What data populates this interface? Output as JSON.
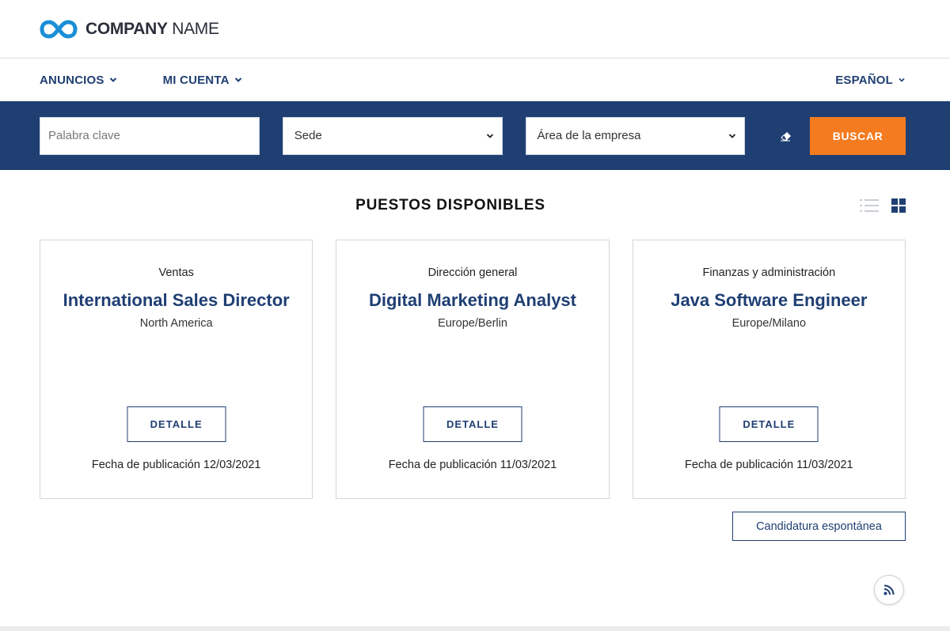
{
  "header": {
    "logo_bold": "COMPANY",
    "logo_light": " NAME",
    "brand_color": "#1a8fd6"
  },
  "nav": {
    "items": [
      {
        "label": "ANUNCIOS"
      },
      {
        "label": "MI CUENTA"
      }
    ],
    "language": "ESPAÑOL"
  },
  "search": {
    "keyword_placeholder": "Palabra clave",
    "location_select": "Sede",
    "area_select": "Área de la empresa",
    "button_label": "BUSCAR",
    "bar_color": "#1f3f73",
    "button_color": "#f47b20"
  },
  "section": {
    "title": "PUESTOS DISPONIBLES"
  },
  "jobs": [
    {
      "area": "Ventas",
      "title": "International Sales Director",
      "location": "North America",
      "detail_label": "DETALLE",
      "pub_date": "Fecha de publicación 12/03/2021"
    },
    {
      "area": "Dirección general",
      "title": "Digital Marketing Analyst",
      "location": "Europe/Berlin",
      "detail_label": "DETALLE",
      "pub_date": "Fecha de publicación 11/03/2021"
    },
    {
      "area": "Finanzas y administración",
      "title": "Java Software Engineer",
      "location": "Europe/Milano",
      "detail_label": "DETALLE",
      "pub_date": "Fecha de publicación 11/03/2021"
    }
  ],
  "spontaneous_label": "Candidatura espontánea"
}
